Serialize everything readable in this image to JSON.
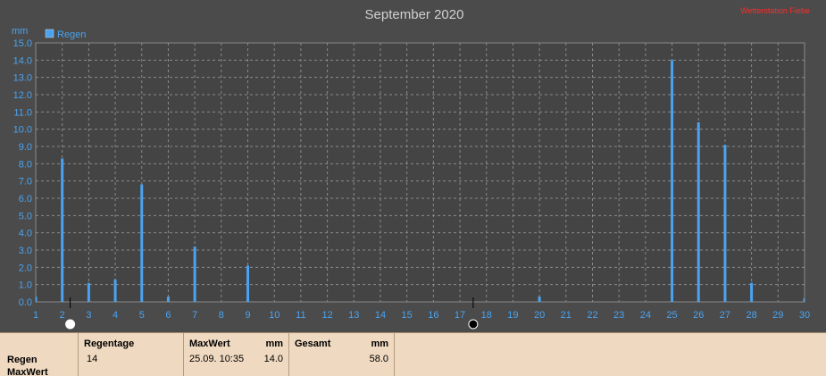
{
  "watermark": "Wetterstation Fiebe",
  "chart_data": {
    "type": "bar",
    "title": "September 2020",
    "ylabel": "mm",
    "ylim": [
      0,
      15
    ],
    "yticks": [
      "0.0",
      "1.0",
      "2.0",
      "3.0",
      "4.0",
      "5.0",
      "6.0",
      "7.0",
      "8.0",
      "9.0",
      "10.0",
      "11.0",
      "12.0",
      "13.0",
      "14.0",
      "15.0"
    ],
    "x": [
      1,
      2,
      3,
      4,
      5,
      6,
      7,
      8,
      9,
      10,
      11,
      12,
      13,
      14,
      15,
      16,
      17,
      18,
      19,
      20,
      21,
      22,
      23,
      24,
      25,
      26,
      27,
      28,
      29,
      30
    ],
    "xticks": [
      "1",
      "2",
      "3",
      "4",
      "5",
      "6",
      "7",
      "8",
      "9",
      "10",
      "11",
      "12",
      "13",
      "14",
      "15",
      "16",
      "17",
      "18",
      "19",
      "20",
      "21",
      "22",
      "23",
      "24",
      "25",
      "26",
      "27",
      "28",
      "29",
      "30"
    ],
    "series": [
      {
        "name": "Regen",
        "color": "#4aa3f0",
        "values": [
          0.3,
          8.3,
          1.1,
          1.3,
          6.8,
          0.3,
          3.2,
          0,
          2.1,
          0,
          0,
          0,
          0,
          0,
          0,
          0,
          0,
          0,
          0,
          0.3,
          0,
          0,
          0,
          0,
          14.0,
          10.4,
          9.1,
          1.1,
          0,
          0.2
        ]
      }
    ],
    "grid": true,
    "legend": "top-left",
    "moon_markers": [
      {
        "day": 2.3,
        "phase": "full-moon"
      },
      {
        "day": 17.5,
        "phase": "new-moon"
      }
    ]
  },
  "summary": {
    "row_labels": [
      "Regen",
      "MaxWert"
    ],
    "columns": [
      {
        "header": "Regentage",
        "unit": "",
        "value_a": "14",
        "value_b": ""
      },
      {
        "header": "MaxWert",
        "unit": "mm",
        "value_a": "25.09.  10:35",
        "value_b": "14.0"
      },
      {
        "header": "Gesamt",
        "unit": "mm",
        "value_a": "",
        "value_b": "58.0"
      }
    ]
  }
}
